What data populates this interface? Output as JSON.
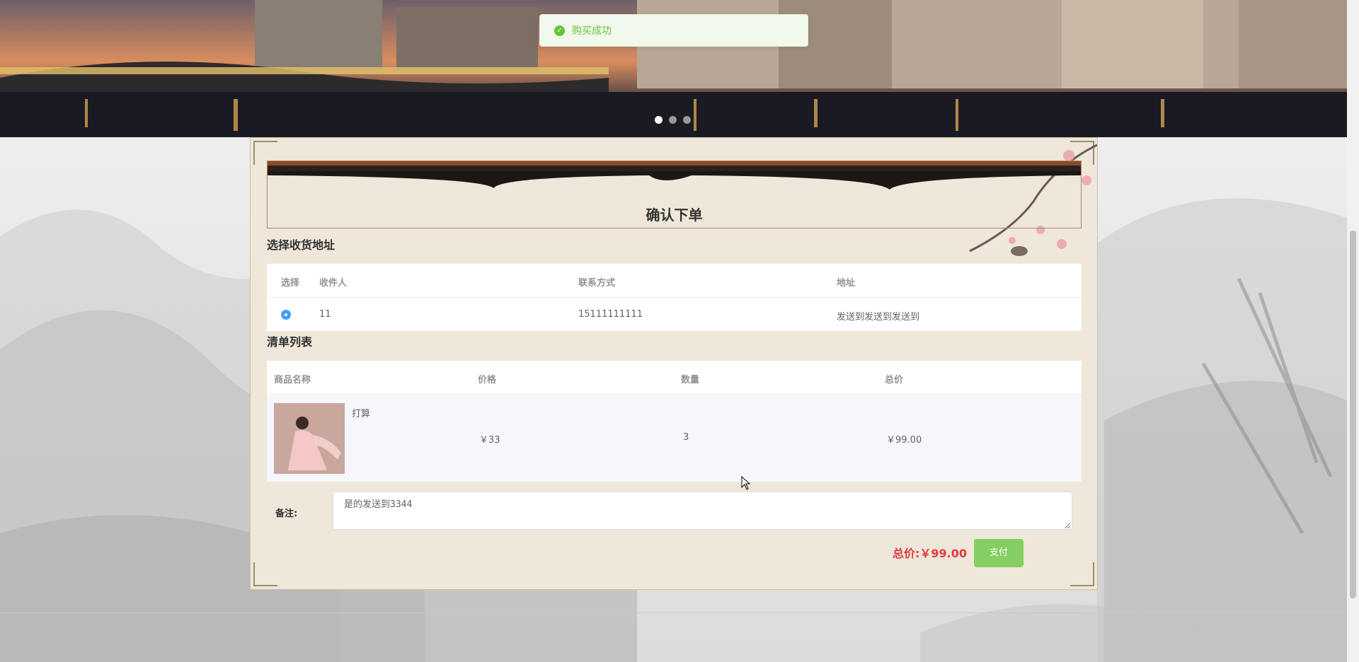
{
  "toast": {
    "message": "购买成功",
    "icon": "check-circle-icon",
    "color": "#67c23a"
  },
  "carousel": {
    "slides": 3,
    "active": 1
  },
  "page": {
    "title": "确认下单"
  },
  "address": {
    "section_title": "选择收货地址",
    "headers": {
      "select": "选择",
      "receiver": "收件人",
      "contact": "联系方式",
      "address": "地址"
    },
    "rows": [
      {
        "selected": true,
        "receiver": "11",
        "contact": "15111111111",
        "address": "发送到发送到发送到"
      }
    ]
  },
  "items": {
    "section_title": "清单列表",
    "headers": {
      "name": "商品名称",
      "price": "价格",
      "qty": "数量",
      "total": "总价"
    },
    "rows": [
      {
        "name": "打算",
        "price": "￥33",
        "qty": "3",
        "total": "￥99.00"
      }
    ]
  },
  "note": {
    "label": "备注:",
    "value": "是的发送到3344"
  },
  "summary": {
    "total_label": "总价:",
    "total_value": "￥99.00",
    "pay_label": "支付"
  },
  "colors": {
    "accent": "#409eff",
    "success": "#67c23a",
    "price_red": "#e4393c",
    "pay_green": "#85ce61"
  }
}
